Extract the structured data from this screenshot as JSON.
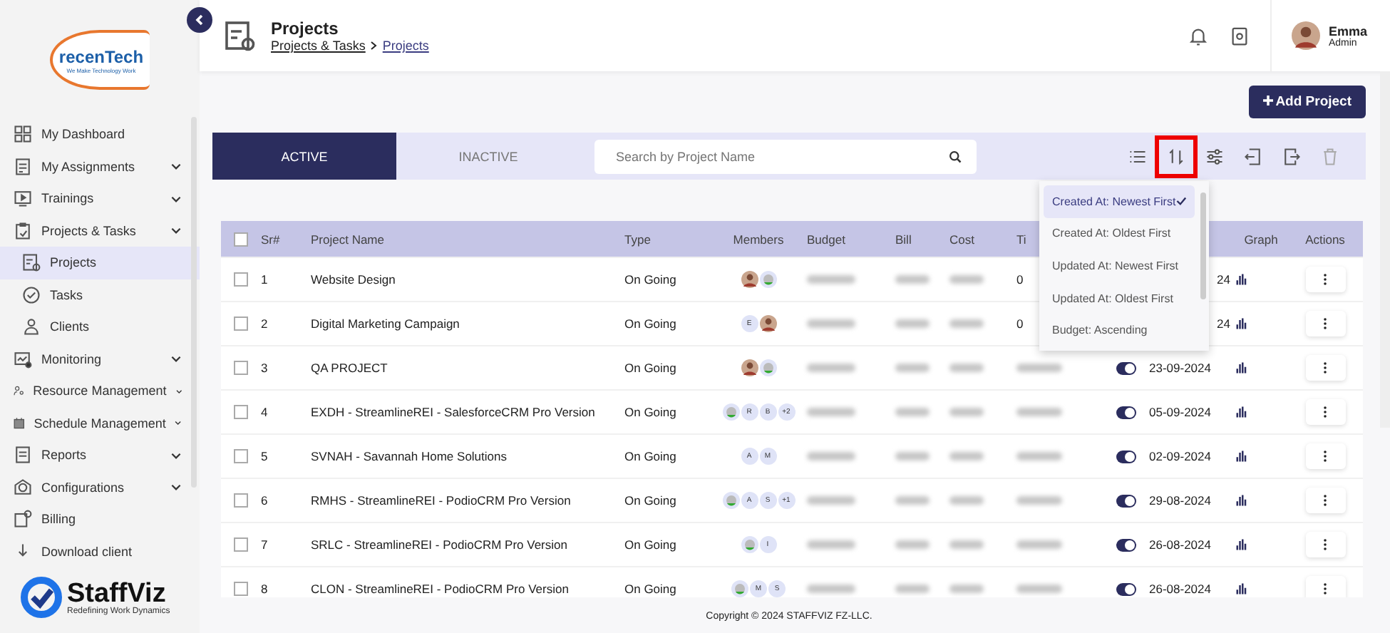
{
  "sidebar": {
    "company_logo": {
      "name": "recenTech",
      "tagline": "We Make Technology Work"
    },
    "items": [
      {
        "label": "My Dashboard",
        "expandable": false,
        "selected": false
      },
      {
        "label": "My Assignments",
        "expandable": true,
        "selected": false
      },
      {
        "label": "Trainings",
        "expandable": true,
        "selected": false
      },
      {
        "label": "Projects & Tasks",
        "expandable": true,
        "selected": false,
        "children": [
          {
            "label": "Projects",
            "selected": true
          },
          {
            "label": "Tasks",
            "selected": false
          },
          {
            "label": "Clients",
            "selected": false
          }
        ]
      },
      {
        "label": "Monitoring",
        "expandable": true,
        "selected": false
      },
      {
        "label": "Resource Management",
        "expandable": true,
        "selected": false
      },
      {
        "label": "Schedule Management",
        "expandable": true,
        "selected": false
      },
      {
        "label": "Reports",
        "expandable": true,
        "selected": false
      },
      {
        "label": "Configurations",
        "expandable": true,
        "selected": false
      },
      {
        "label": "Billing",
        "expandable": false,
        "selected": false
      },
      {
        "label": "Download client",
        "expandable": false,
        "selected": false
      }
    ],
    "product_logo": {
      "name": "StaffViz",
      "tagline": "Redefining Work Dynamics"
    }
  },
  "header": {
    "title": "Projects",
    "breadcrumb": [
      "Projects & Tasks",
      "Projects"
    ],
    "user": {
      "name": "Emma",
      "role": "Admin"
    }
  },
  "add_button": "Add Project",
  "tabs": [
    {
      "label": "ACTIVE",
      "selected": true
    },
    {
      "label": "INACTIVE",
      "selected": false
    }
  ],
  "search": {
    "placeholder": "Search by Project Name"
  },
  "sort_menu": {
    "items": [
      {
        "label": "Created At: Newest First",
        "selected": true
      },
      {
        "label": "Created At: Oldest First",
        "selected": false
      },
      {
        "label": "Updated At: Newest First",
        "selected": false
      },
      {
        "label": "Updated At: Oldest First",
        "selected": false
      },
      {
        "label": "Budget: Ascending",
        "selected": false
      }
    ]
  },
  "table": {
    "all_checked": false,
    "columns": [
      "Sr#",
      "Project Name",
      "Type",
      "Members",
      "Budget",
      "Bill",
      "Cost",
      "Ti",
      "",
      "",
      "Graph",
      "Actions"
    ],
    "rows": [
      {
        "checked": false,
        "sr": "1",
        "name": "Website Design",
        "type": "On Going",
        "members": [
          {
            "kind": "photo"
          },
          {
            "kind": "generic"
          }
        ],
        "time": "0",
        "date": "24"
      },
      {
        "checked": false,
        "sr": "2",
        "name": "Digital Marketing Campaign",
        "type": "On Going",
        "members": [
          {
            "kind": "initial",
            "text": "E"
          },
          {
            "kind": "photo"
          }
        ],
        "time": "0",
        "date": "24"
      },
      {
        "checked": false,
        "sr": "3",
        "name": "QA PROJECT",
        "type": "On Going",
        "members": [
          {
            "kind": "photo"
          },
          {
            "kind": "generic"
          }
        ],
        "on": true,
        "date": "23-09-2024"
      },
      {
        "checked": false,
        "sr": "4",
        "name": "EXDH - StreamlineREI - SalesforceCRM Pro Version",
        "type": "On Going",
        "members": [
          {
            "kind": "generic"
          },
          {
            "kind": "initial",
            "text": "R"
          },
          {
            "kind": "initial",
            "text": "B"
          },
          {
            "kind": "initial",
            "text": "+2"
          }
        ],
        "on": true,
        "date": "05-09-2024"
      },
      {
        "checked": false,
        "sr": "5",
        "name": "SVNAH - Savannah Home Solutions",
        "type": "On Going",
        "members": [
          {
            "kind": "initial",
            "text": "A"
          },
          {
            "kind": "initial",
            "text": "M"
          }
        ],
        "on": true,
        "date": "02-09-2024"
      },
      {
        "checked": false,
        "sr": "6",
        "name": "RMHS - StreamlineREI - PodioCRM Pro Version",
        "type": "On Going",
        "members": [
          {
            "kind": "generic"
          },
          {
            "kind": "initial",
            "text": "A"
          },
          {
            "kind": "initial",
            "text": "S"
          },
          {
            "kind": "initial",
            "text": "+1"
          }
        ],
        "on": true,
        "date": "29-08-2024"
      },
      {
        "checked": false,
        "sr": "7",
        "name": "SRLC - StreamlineREI - PodioCRM Pro Version",
        "type": "On Going",
        "members": [
          {
            "kind": "generic"
          },
          {
            "kind": "initial",
            "text": "I"
          }
        ],
        "on": true,
        "date": "26-08-2024"
      },
      {
        "checked": false,
        "sr": "8",
        "name": "CLON - StreamlineREI - PodioCRM Pro Version",
        "type": "On Going",
        "members": [
          {
            "kind": "generic"
          },
          {
            "kind": "initial",
            "text": "M"
          },
          {
            "kind": "initial",
            "text": "S"
          }
        ],
        "on": true,
        "date": "26-08-2024"
      }
    ]
  },
  "footer": "Copyright © 2024 STAFFVIZ FZ-LLC."
}
